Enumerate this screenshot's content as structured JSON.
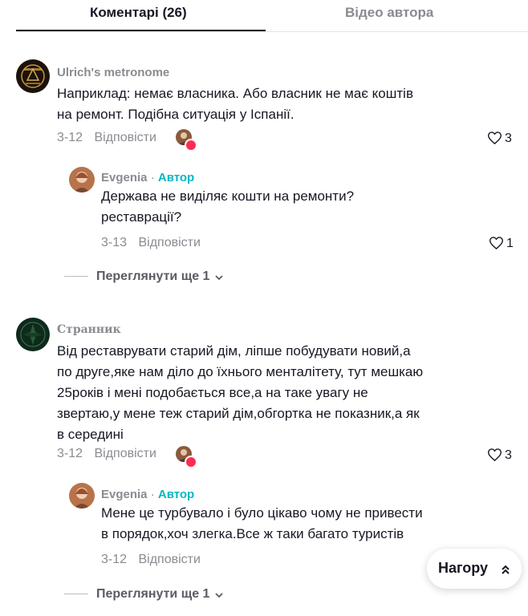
{
  "tabs": {
    "comments": "Коментарі (26)",
    "creator_videos": "Відео автора"
  },
  "comments": [
    {
      "username": "Ulrich's metronome",
      "text_lines": [
        "Наприклад: немає власника. Або власник не має коштів",
        "на ремонт. Подібна ситуація у Іспанії."
      ],
      "date": "3-12",
      "reply_label": "Відповісти",
      "likes": "3",
      "reply": {
        "username": "Evgenia",
        "author_tag": "Автор",
        "separator": "·",
        "text_lines": [
          "Держава не виділяє кошти на ремонти?",
          "реставрації?"
        ],
        "date": "3-13",
        "reply_label": "Відповісти",
        "likes": "1"
      },
      "view_more": "Переглянути ще 1"
    },
    {
      "username": "Странник",
      "text_lines": [
        "Від реставрувати старий дім, ліпше побудувати новий,а",
        "по друге,яке нам діло до їхнього менталітету, тут мешкаю",
        "25років і мені подобається все,а на таке увагу не",
        "звертаю,у мене теж старий дім,обгортка не показник,а як",
        "в середині"
      ],
      "date": "3-12",
      "reply_label": "Відповісти",
      "likes": "3",
      "reply": {
        "username": "Evgenia",
        "author_tag": "Автор",
        "separator": "·",
        "text_lines": [
          "Мене це турбувало і було цікаво чому не привести",
          "в порядок,хоч злегка.Все ж таки багато туристів"
        ],
        "date": "3-12",
        "reply_label": "Відповісти"
      },
      "view_more": "Переглянути ще 1"
    }
  ],
  "back_to_top": "Нагору",
  "colors": {
    "author_accent": "#00b7c4",
    "like_badge": "#fe2c55",
    "muted_text": "#8a8b91"
  }
}
